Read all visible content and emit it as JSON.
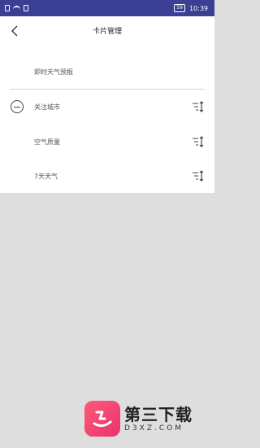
{
  "status_bar": {
    "battery": "59",
    "time": "10:39"
  },
  "header": {
    "title": "卡片管理"
  },
  "cards": [
    {
      "label": "即时天气预报",
      "removable": false,
      "draggable": false
    },
    {
      "label": "关注城市",
      "removable": true,
      "draggable": true
    },
    {
      "label": "空气质量",
      "removable": false,
      "draggable": true
    },
    {
      "label": "7天天气",
      "removable": false,
      "draggable": true
    }
  ],
  "watermark": {
    "title": "第三下载",
    "subtitle": "D3XZ.COM"
  },
  "colors": {
    "status_bar": "#3a3f93",
    "panel": "#ffffff",
    "backdrop": "#dedede",
    "logo": "#e8336c"
  }
}
